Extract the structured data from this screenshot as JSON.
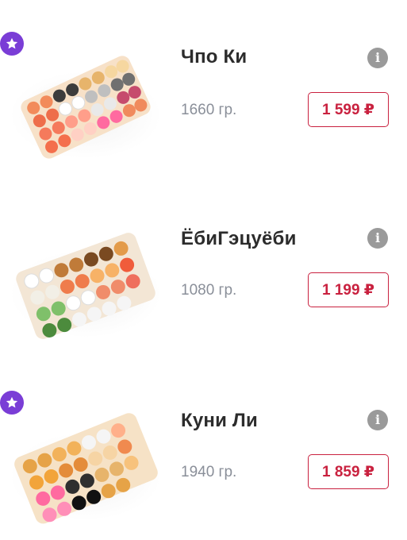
{
  "products": [
    {
      "title": "Чпо Ки",
      "weight": "1660 гр.",
      "price": "1 599 ₽",
      "favorite": true,
      "info_icon": "info-icon"
    },
    {
      "title": "ЁбиГэцуёби",
      "weight": "1080 гр.",
      "price": "1 199 ₽",
      "favorite": false,
      "info_icon": "info-icon"
    },
    {
      "title": "Куни Ли",
      "weight": "1940 гр.",
      "price": "1 859 ₽",
      "favorite": true,
      "info_icon": "info-icon"
    }
  ],
  "colors": {
    "accent": "#c9213f",
    "favorite": "#7a3dd6",
    "info": "#9a9a9a",
    "weight_text": "#8a8f99",
    "title_text": "#2c2c2c"
  }
}
